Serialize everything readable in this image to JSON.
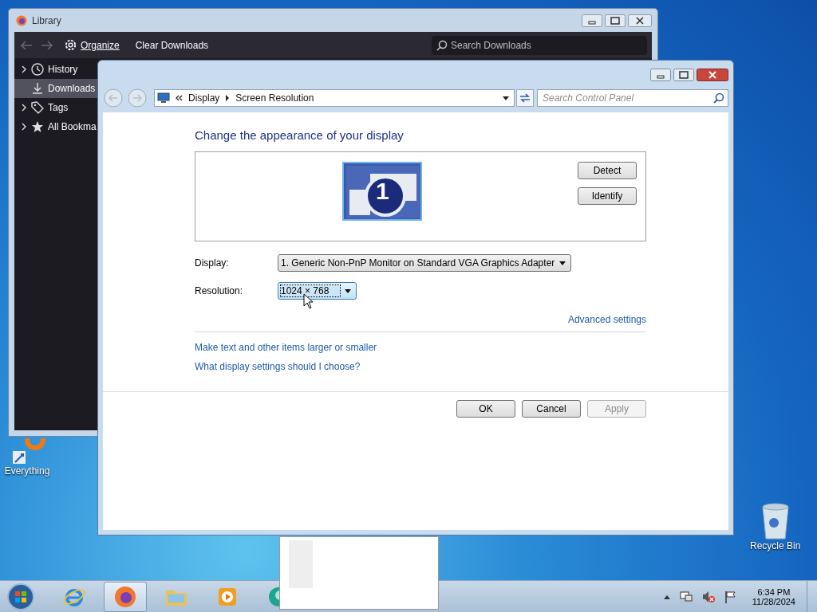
{
  "library": {
    "title": "Library",
    "toolbar": {
      "organize": "Organize",
      "clear": "Clear Downloads",
      "search": {
        "placeholder": "Search Downloads"
      }
    },
    "sidebar": [
      {
        "label": "History",
        "kind": "clock",
        "expandable": true,
        "selected": false
      },
      {
        "label": "Downloads",
        "kind": "download",
        "expandable": false,
        "selected": true
      },
      {
        "label": "Tags",
        "kind": "tag",
        "expandable": true,
        "selected": false
      },
      {
        "label": "All Bookma",
        "kind": "star",
        "expandable": true,
        "selected": false
      }
    ]
  },
  "control_panel": {
    "breadcrumb": [
      "Display",
      "Screen Resolution"
    ],
    "search": {
      "placeholder": "Search Control Panel"
    },
    "heading": "Change the appearance of your display",
    "monitor_number": "1",
    "side_buttons": [
      "Detect",
      "Identify"
    ],
    "fields": [
      {
        "label": "Display:",
        "value": "1. Generic Non-PnP Monitor on Standard VGA Graphics Adapter",
        "focused": false
      },
      {
        "label": "Resolution:",
        "value": "1024 × 768",
        "focused": true
      }
    ],
    "advanced_link": "Advanced settings",
    "links": [
      "Make text and other items larger or smaller",
      "What display settings should I choose?"
    ],
    "buttons": [
      {
        "label": "OK",
        "disabled": false
      },
      {
        "label": "Cancel",
        "disabled": false
      },
      {
        "label": "Apply",
        "disabled": true
      }
    ]
  },
  "desktop_icons": [
    {
      "label": "Everything",
      "kind": "everything"
    },
    {
      "label": "Recycle Bin",
      "kind": "recycle"
    }
  ],
  "taskbar": {
    "apps": [
      {
        "kind": "ie",
        "selected": false
      },
      {
        "kind": "firefox",
        "selected": true
      },
      {
        "kind": "folder",
        "selected": false
      },
      {
        "kind": "media",
        "selected": false
      },
      {
        "kind": "teal",
        "selected": false
      }
    ],
    "clock": {
      "time": "6:34 PM",
      "date": "11/28/2024"
    }
  }
}
